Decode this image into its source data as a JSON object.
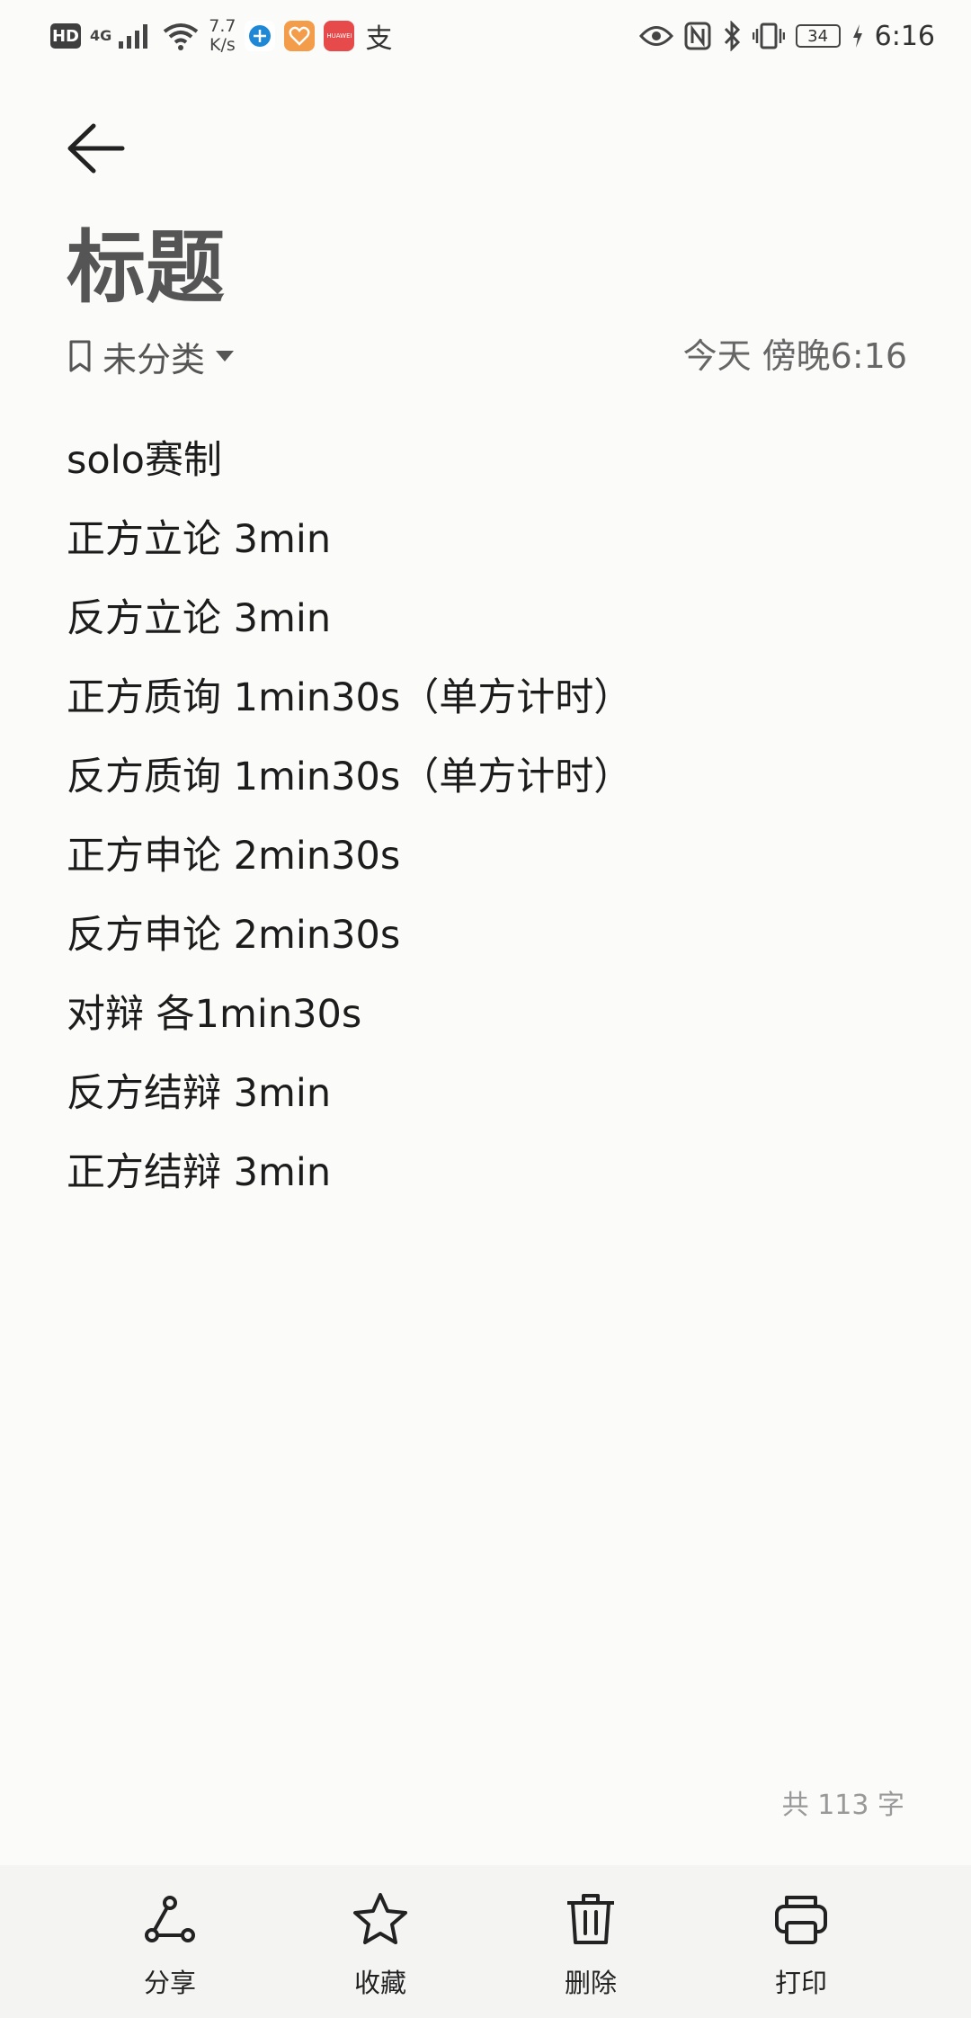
{
  "status_bar": {
    "hd": "HD",
    "network": "4G",
    "speed_value": "7.7",
    "speed_unit": "K/s",
    "huawei_badge": "HUAWEI",
    "alipay_glyph": "支",
    "battery": "34",
    "time": "6:16",
    "icons": [
      "hd-icon",
      "signal-icon",
      "wifi-icon",
      "browser-icon",
      "health-icon",
      "huawei-icon",
      "alipay-icon",
      "eye-icon",
      "nfc-icon",
      "bluetooth-icon",
      "vibrate-icon",
      "battery-icon",
      "charging-icon"
    ]
  },
  "header": {
    "back_icon": "arrow-left-icon",
    "title": "标题",
    "category": "未分类",
    "category_icon": "bookmark-icon",
    "dropdown_icon": "caret-down-icon",
    "timestamp": "今天 傍晚6:16"
  },
  "note": {
    "lines": [
      "solo赛制",
      "正方立论 3min",
      "反方立论 3min",
      "正方质询 1min30s（单方计时）",
      "反方质询 1min30s（单方计时）",
      "正方申论 2min30s",
      "反方申论 2min30s",
      "对辩 各1min30s",
      "反方结辩 3min",
      "正方结辩 3min"
    ],
    "word_count": "共 113 字"
  },
  "toolbar": {
    "share_label": "分享",
    "favorite_label": "收藏",
    "delete_label": "删除",
    "print_label": "打印",
    "icons": [
      "share-icon",
      "star-icon",
      "trash-icon",
      "printer-icon"
    ]
  }
}
